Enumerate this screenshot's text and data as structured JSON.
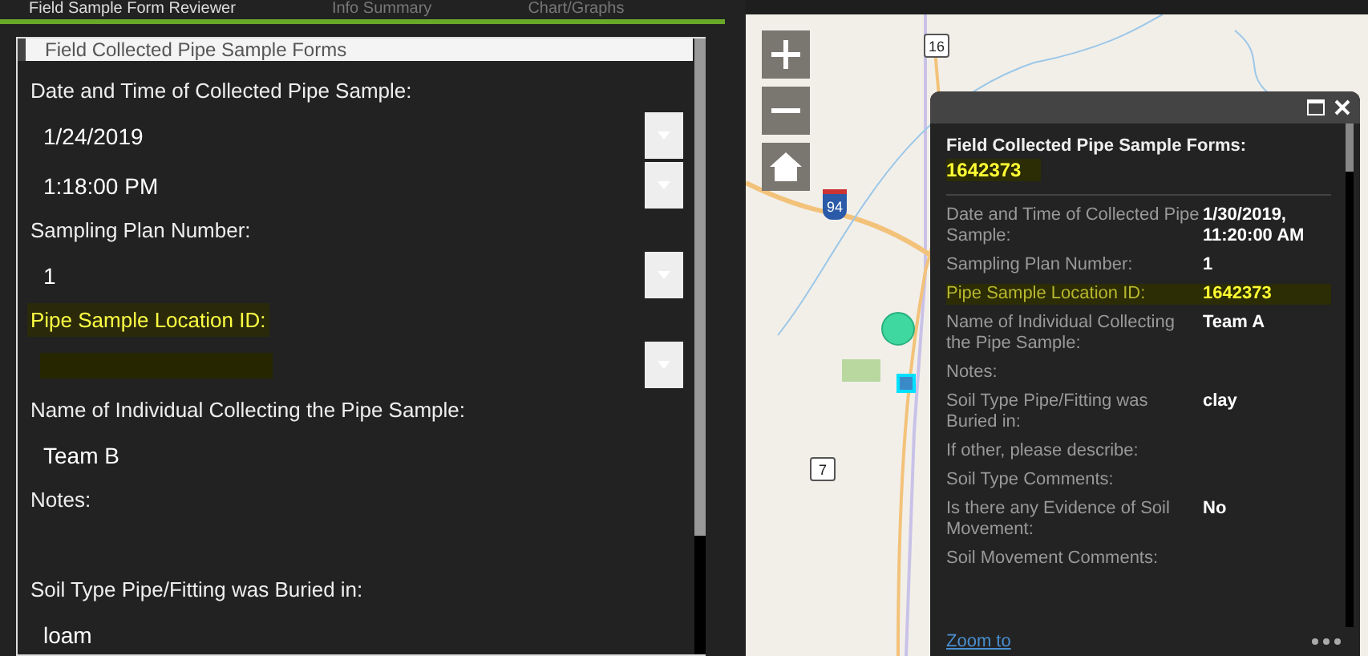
{
  "tabs": [
    {
      "label": "Field Sample Form Reviewer",
      "selected": true
    },
    {
      "label": "Info Summary",
      "selected": false
    },
    {
      "label": "Chart/Graphs",
      "selected": false
    }
  ],
  "form": {
    "title": "Field Collected Pipe Sample Forms",
    "fields": [
      {
        "label": "Date and Time of Collected Pipe Sample:",
        "highlighted": false,
        "inputs": [
          {
            "value": "1/24/2019",
            "dropdown": true,
            "redacted": false
          },
          {
            "value": "1:18:00 PM",
            "dropdown": true,
            "redacted": false
          }
        ]
      },
      {
        "label": "Sampling Plan Number:",
        "highlighted": false,
        "inputs": [
          {
            "value": "1",
            "dropdown": true,
            "redacted": false
          }
        ]
      },
      {
        "label": "Pipe Sample Location ID:",
        "highlighted": true,
        "inputs": [
          {
            "dropdown": true,
            "redacted": true
          }
        ]
      },
      {
        "label": "Name of Individual Collecting the Pipe Sample:",
        "highlighted": false,
        "inputs": [
          {
            "value": "Team B",
            "dropdown": false,
            "redacted": false
          }
        ]
      },
      {
        "label": "Notes:",
        "highlighted": false
      },
      {
        "label": "Soil Type Pipe/Fitting was Buried in:",
        "highlighted": false,
        "inputs": [
          {
            "value": "loam",
            "dropdown": false,
            "redacted": false
          }
        ]
      }
    ]
  },
  "map": {
    "shields": [
      {
        "label": "16",
        "kind": "state"
      },
      {
        "label": "94",
        "kind": "interstate"
      },
      {
        "label": "7",
        "kind": "state"
      }
    ]
  },
  "popup": {
    "title": "Field Collected Pipe Sample Forms:",
    "title_id": "1642373",
    "title_highlighted": true,
    "rows": [
      {
        "label": "Date and Time of Collected Pipe Sample:",
        "value": "1/30/2019, 11:20:00 AM",
        "highlighted": false
      },
      {
        "label": "Sampling Plan Number:",
        "value": "1",
        "highlighted": false
      },
      {
        "label": "Pipe Sample Location ID:",
        "value": "1642373",
        "highlighted": true
      },
      {
        "label": "Name of Individual Collecting the Pipe Sample:",
        "value": "Team A",
        "highlighted": false
      },
      {
        "label": "Notes:",
        "highlighted": false
      },
      {
        "label": "Soil Type Pipe/Fitting was Buried in:",
        "value": "clay",
        "highlighted": false
      },
      {
        "label": "If other, please describe:",
        "highlighted": false
      },
      {
        "label": "Soil Type Comments:",
        "highlighted": false
      },
      {
        "label": "Is there any Evidence of Soil Movement:",
        "value": "No",
        "highlighted": false
      },
      {
        "label": "Soil Movement Comments:",
        "highlighted": false
      }
    ],
    "link": "Zoom to"
  }
}
